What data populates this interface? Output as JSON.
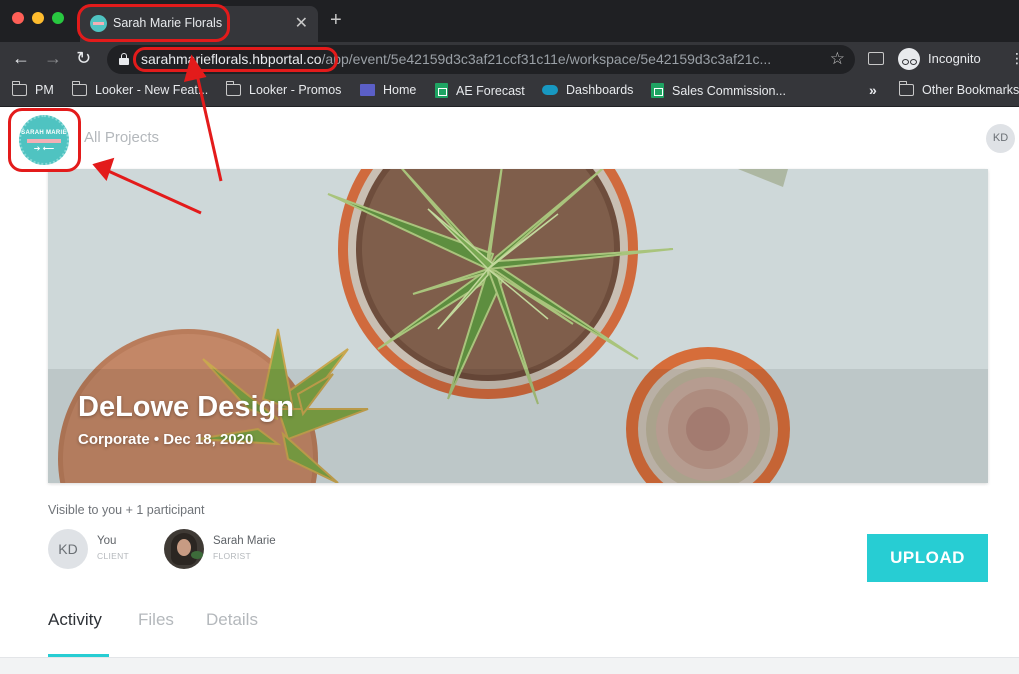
{
  "browser": {
    "tab": {
      "title": "Sarah Marie Florals"
    },
    "address": {
      "host": "sarahmarieflorals.hbportal.co",
      "path": "/app/event/5e42159d3c3af21ccf31c11e/workspace/5e42159d3c3af21c..."
    },
    "profile_label": "Incognito",
    "bookmarks": [
      {
        "label": "PM",
        "icon": "folder-icon"
      },
      {
        "label": "Looker - New Feat...",
        "icon": "folder-icon"
      },
      {
        "label": "Looker - Promos",
        "icon": "folder-icon"
      },
      {
        "label": "Home",
        "icon": "calendar-icon"
      },
      {
        "label": "AE Forecast",
        "icon": "sheets-icon"
      },
      {
        "label": "Dashboards",
        "icon": "salesforce-cloud-icon"
      },
      {
        "label": "Sales Commission...",
        "icon": "sheets-icon"
      }
    ],
    "overflow_label": "»",
    "other_bookmarks": "Other Bookmarks"
  },
  "header": {
    "logo": {
      "top_text": "SARAH MARIE",
      "arrows": "➔ ⟵"
    },
    "all_projects": "All Projects",
    "user_initials": "KD"
  },
  "project": {
    "title": "DeLowe Design",
    "subtitle": "Corporate • Dec 18, 2020"
  },
  "participants": {
    "visibility": "Visible to you + 1 participant",
    "list": [
      {
        "initials": "KD",
        "name": "You",
        "role": "CLIENT"
      },
      {
        "name": "Sarah Marie",
        "role": "FLORIST"
      }
    ]
  },
  "actions": {
    "upload": "UPLOAD"
  },
  "tabs": [
    {
      "label": "Activity",
      "active": true
    },
    {
      "label": "Files",
      "active": false
    },
    {
      "label": "Details",
      "active": false
    }
  ],
  "colors": {
    "accent": "#27cdd3",
    "annotation": "#e31b1b",
    "brand_teal": "#4fc3c1",
    "brand_pink": "#f3b0b6"
  }
}
